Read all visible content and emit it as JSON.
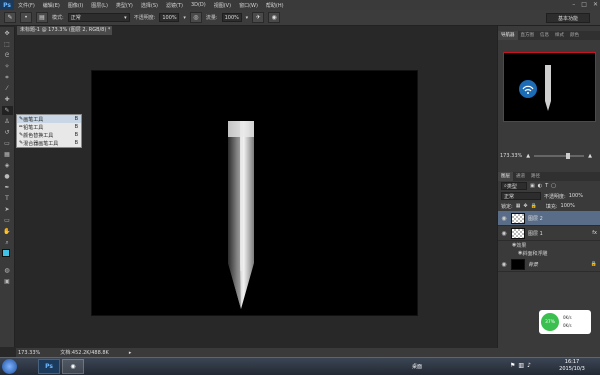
{
  "app": {
    "logo": "Ps"
  },
  "menu": [
    "文件(F)",
    "编辑(E)",
    "图像(I)",
    "图层(L)",
    "类型(Y)",
    "选择(S)",
    "滤镜(T)",
    "3D(D)",
    "视图(V)",
    "窗口(W)",
    "帮助(H)"
  ],
  "window_controls": [
    "–",
    "□",
    "✕"
  ],
  "options": {
    "mode_label": "模式:",
    "mode_value": "正常",
    "opacity_label": "不透明度:",
    "opacity_value": "100%",
    "flow_label": "流量:",
    "flow_value": "100%"
  },
  "workspace_select": "基本功能",
  "document_tab": "未标题-1 @ 173.3% (图层 2, RGB/8) *",
  "tool_flyout": [
    {
      "label": "画笔工具",
      "key": "B",
      "active": true
    },
    {
      "label": "铅笔工具",
      "key": "B",
      "active": false
    },
    {
      "label": "颜色替换工具",
      "key": "B",
      "active": false
    },
    {
      "label": "混合器画笔工具",
      "key": "B",
      "active": false
    }
  ],
  "panel_tabs_top": [
    "导航器",
    "直方图",
    "信息",
    "样式",
    "颜色"
  ],
  "navigator_zoom": "173.33%",
  "panel_tabs_layers": [
    "图层",
    "通道",
    "路径"
  ],
  "layers_panel": {
    "filter_label": "类型",
    "blend_mode": "正常",
    "opacity_label": "不透明度:",
    "opacity_value": "100%",
    "lock_label": "锁定:",
    "fill_label": "填充:",
    "fill_value": "100%",
    "layers": [
      {
        "name": "图层 2",
        "selected": true,
        "fx": false
      },
      {
        "name": "图层 1",
        "selected": false,
        "fx": true
      },
      {
        "name": "背景",
        "selected": false,
        "fx": false
      }
    ],
    "effects_label": "效果",
    "effect_item": "斜面和浮雕"
  },
  "status": {
    "zoom": "173.33%",
    "doc": "文档:452.2K/488.8K"
  },
  "taskbar": {
    "desktop_label": "桌面",
    "time": "16:17",
    "date": "2015/10/3"
  },
  "widget": {
    "percent": "37%",
    "speed1": "0K/s",
    "speed2": "0K/s"
  },
  "colors": {
    "accent": "#5a6d88",
    "canvas": "#000000",
    "nav_border": "#cc1122"
  }
}
